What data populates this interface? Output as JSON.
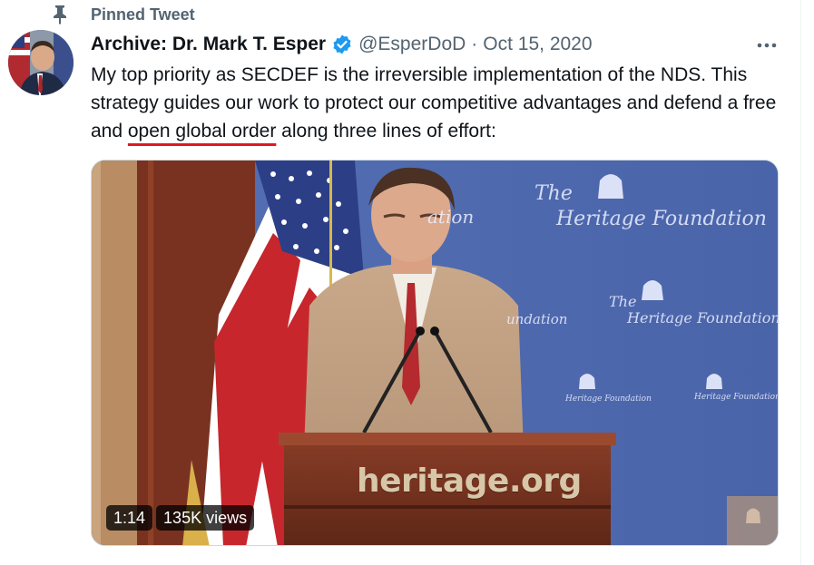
{
  "pinned_label": "Pinned Tweet",
  "author": {
    "display_name": "Archive: Dr. Mark T. Esper",
    "handle": "@EsperDoD",
    "separator": "·",
    "date": "Oct 15, 2020"
  },
  "tweet": {
    "text_before": "My top priority as SECDEF is the irreversible implementation of the NDS. This strategy guides our work to protect our competitive advantages and defend a free and ",
    "text_highlight": "open global order",
    "text_after": " along three lines of effort:"
  },
  "video": {
    "duration": "1:14",
    "views": "135K views",
    "podium_text": "heritage.org",
    "watermark_the": "The",
    "watermark_name": "Heritage Foundation",
    "watermark_partial": "ation",
    "watermark_partial2": "undation"
  },
  "colors": {
    "accent": "#1d9bf0",
    "secondary_text": "#536471",
    "underline": "#e0191f",
    "backdrop": "#4a62a8"
  },
  "icons": {
    "pin": "pin-icon",
    "verified": "verified-badge-icon",
    "more": "more-horizontal-icon"
  }
}
